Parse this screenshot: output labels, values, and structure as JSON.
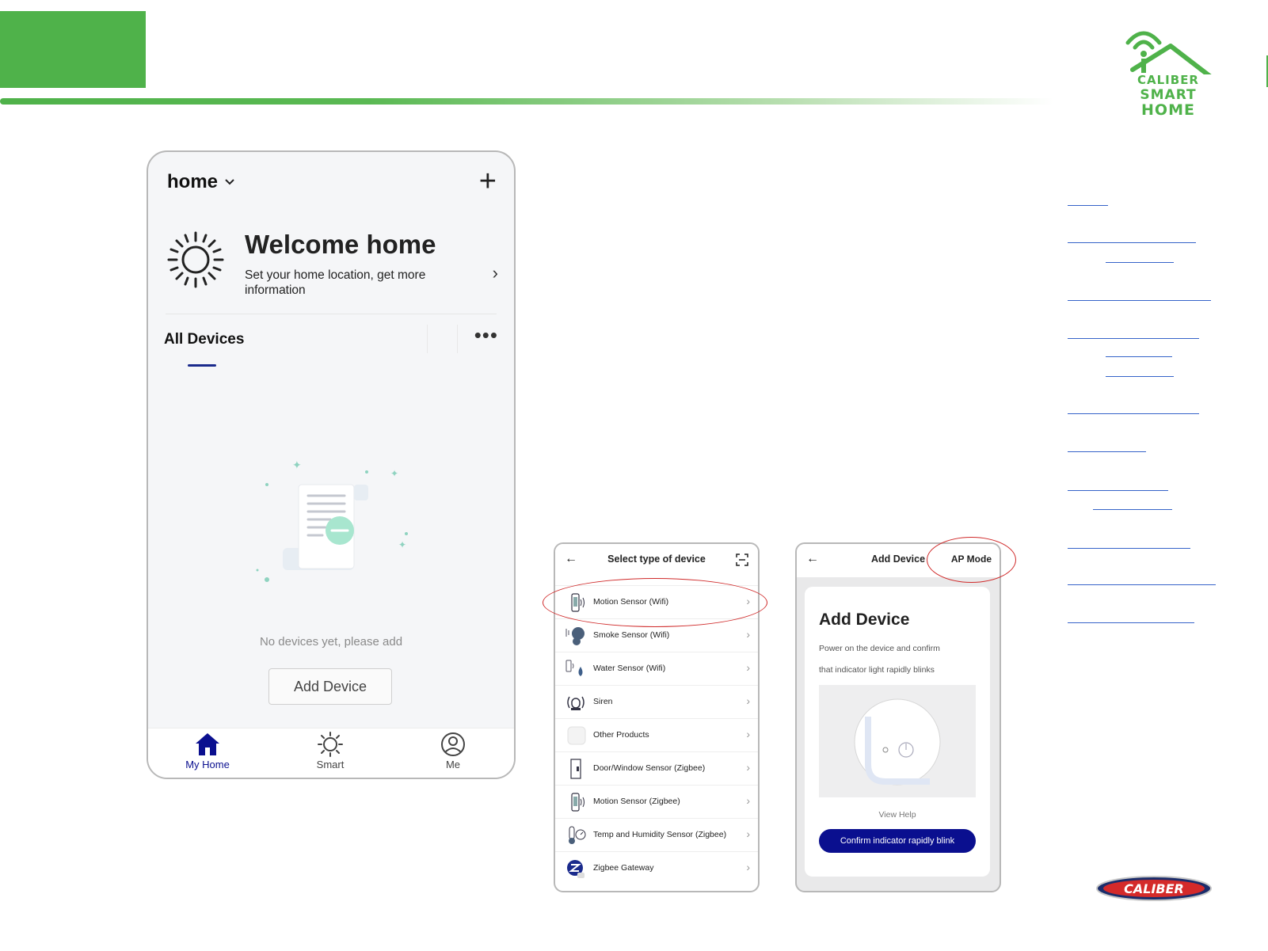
{
  "main_phone": {
    "home_selector": "home",
    "welcome": {
      "title": "Welcome home",
      "subtitle": "Set your home location, get more information"
    },
    "section_title": "All Devices",
    "empty_text": "No devices yet, please add",
    "add_device_button": "Add Device",
    "tabs": [
      {
        "label": "My Home"
      },
      {
        "label": "Smart"
      },
      {
        "label": "Me"
      }
    ]
  },
  "select_phone": {
    "title": "Select type of device",
    "rows": [
      {
        "label": "Motion Sensor (Wifi)"
      },
      {
        "label": "Smoke Sensor (Wifi)"
      },
      {
        "label": "Water Sensor (Wifi)"
      },
      {
        "label": "Siren"
      },
      {
        "label": "Other Products"
      },
      {
        "label": "Door/Window Sensor (Zigbee)"
      },
      {
        "label": "Motion Sensor (Zigbee)"
      },
      {
        "label": "Temp and Humidity Sensor (Zigbee)"
      },
      {
        "label": "Zigbee Gateway"
      }
    ]
  },
  "add_phone": {
    "title": "Add Device",
    "mode_link": "AP Mode",
    "card_title": "Add Device",
    "desc_line1": "Power on the device and confirm",
    "desc_line2": "that indicator light rapidly blinks",
    "view_help": "View Help",
    "confirm_button": "Confirm indicator rapidly blink"
  },
  "logo": {
    "line1": "CALIBER",
    "line2": "SMART",
    "line3": "HOME",
    "brand_badge": "CALIBER"
  },
  "colors": {
    "brand_green": "#4fb24a",
    "tab_active": "#0a0f8f",
    "highlight_red": "#d02a2a",
    "link_blue": "#3563c9"
  }
}
